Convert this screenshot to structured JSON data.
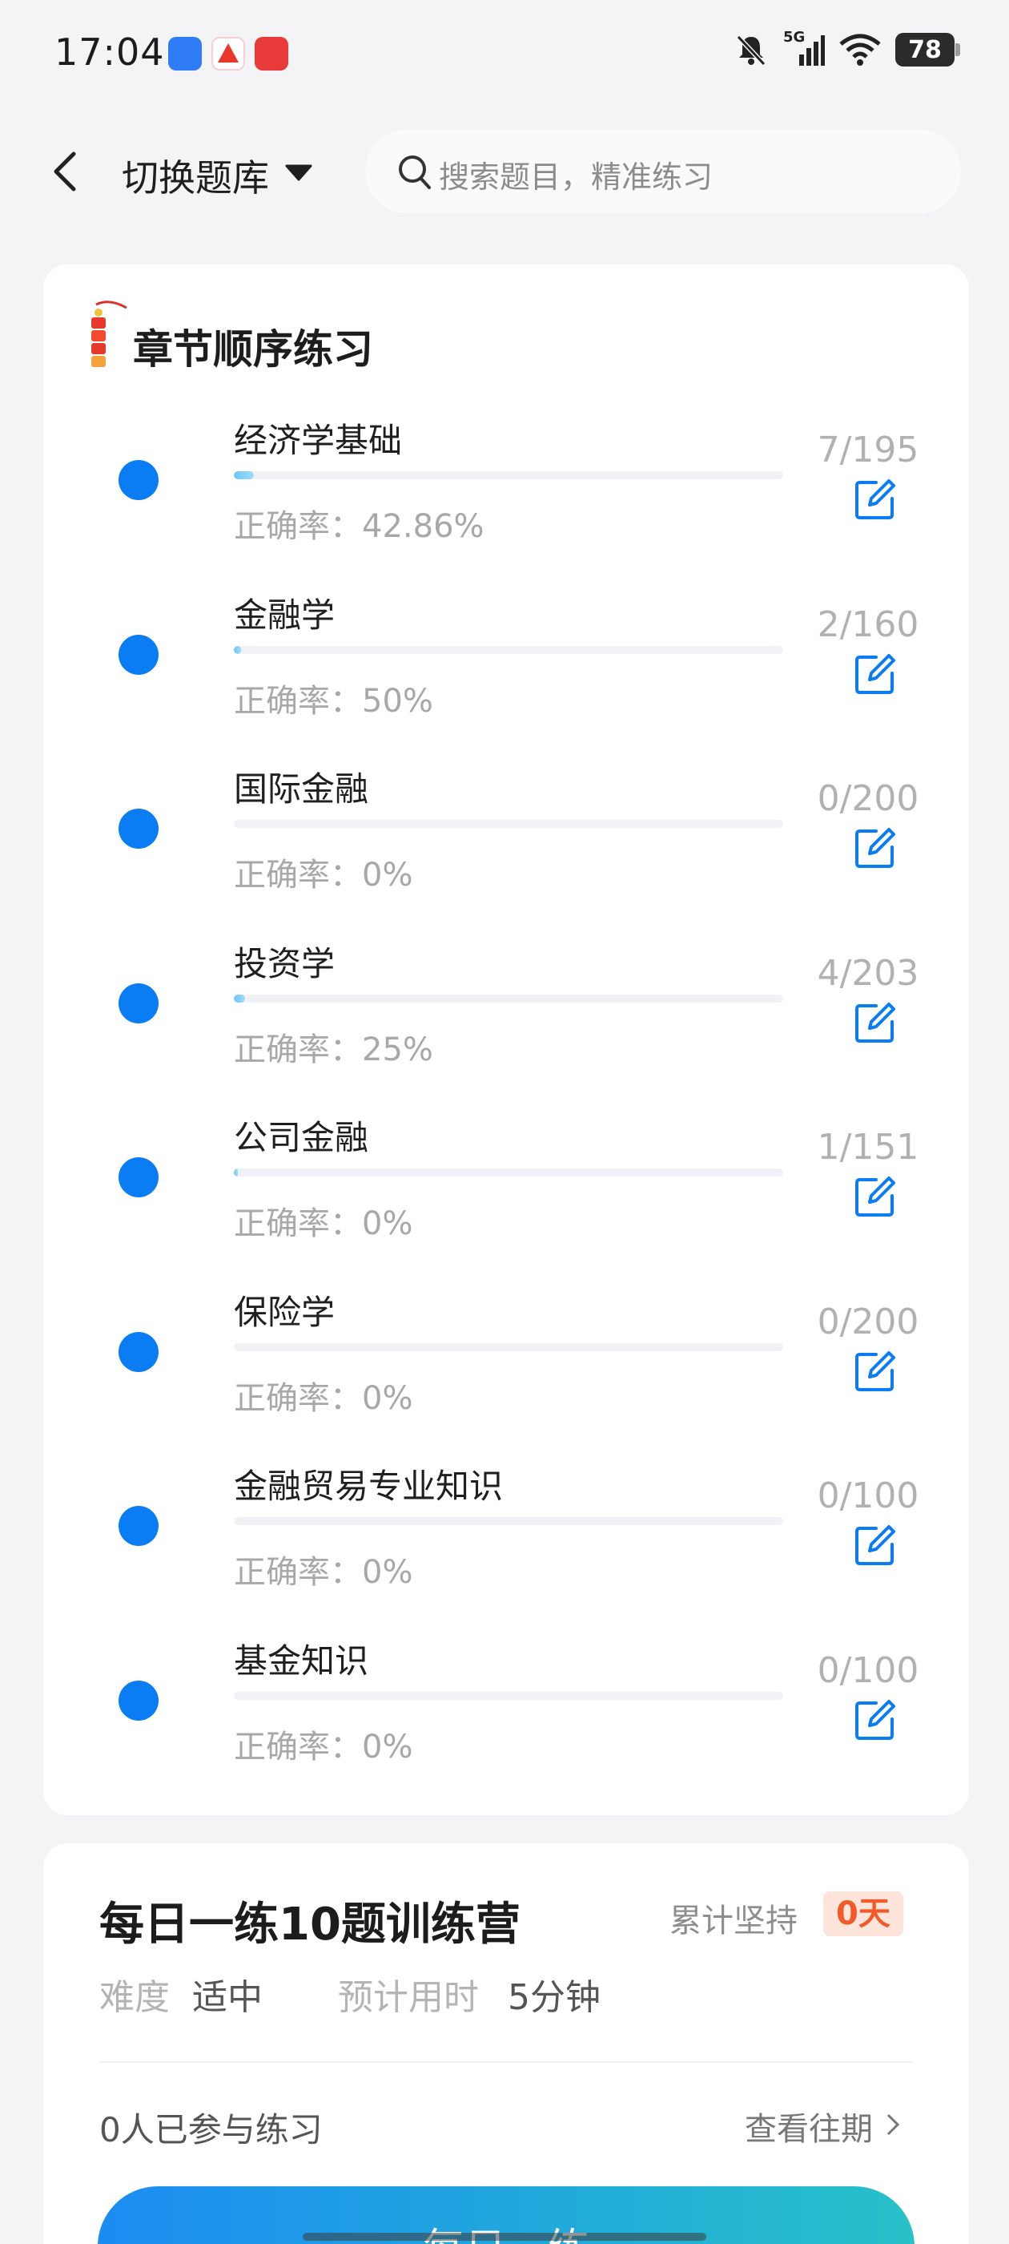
{
  "status_bar": {
    "time": "17:04",
    "network": "5G",
    "battery": "78",
    "icons": [
      "notifications-muted-icon",
      "signal-icon",
      "wifi-icon",
      "battery-icon"
    ]
  },
  "header": {
    "switch_label": "切换题库",
    "search_placeholder": "搜索题目，精准练习"
  },
  "chapters": {
    "title": "章节顺序练习",
    "accuracy_prefix": "正确率：",
    "items": [
      {
        "name": "经济学基础",
        "accuracy": "42.86%",
        "count": "7/195",
        "progress": 0.036
      },
      {
        "name": "金融学",
        "accuracy": "50%",
        "count": "2/160",
        "progress": 0.0125
      },
      {
        "name": "国际金融",
        "accuracy": "0%",
        "count": "0/200",
        "progress": 0
      },
      {
        "name": "投资学",
        "accuracy": "25%",
        "count": "4/203",
        "progress": 0.0197
      },
      {
        "name": "公司金融",
        "accuracy": "0%",
        "count": "1/151",
        "progress": 0.0066
      },
      {
        "name": "保险学",
        "accuracy": "0%",
        "count": "0/200",
        "progress": 0
      },
      {
        "name": "金融贸易专业知识",
        "accuracy": "0%",
        "count": "0/100",
        "progress": 0
      },
      {
        "name": "基金知识",
        "accuracy": "0%",
        "count": "0/100",
        "progress": 0
      }
    ]
  },
  "daily": {
    "title": "每日一练10题训练营",
    "streak_label": "累计坚持",
    "streak_value": "0天",
    "difficulty_label": "难度",
    "difficulty_value": "适中",
    "time_label": "预计用时",
    "time_value": "5分钟",
    "participants": "0人已参与练习",
    "history_link": "查看往期",
    "start_button": "每日一练"
  },
  "colors": {
    "accent": "#0a7cf4",
    "progress": "#6cc6f5",
    "streak": "#f25a2a"
  }
}
